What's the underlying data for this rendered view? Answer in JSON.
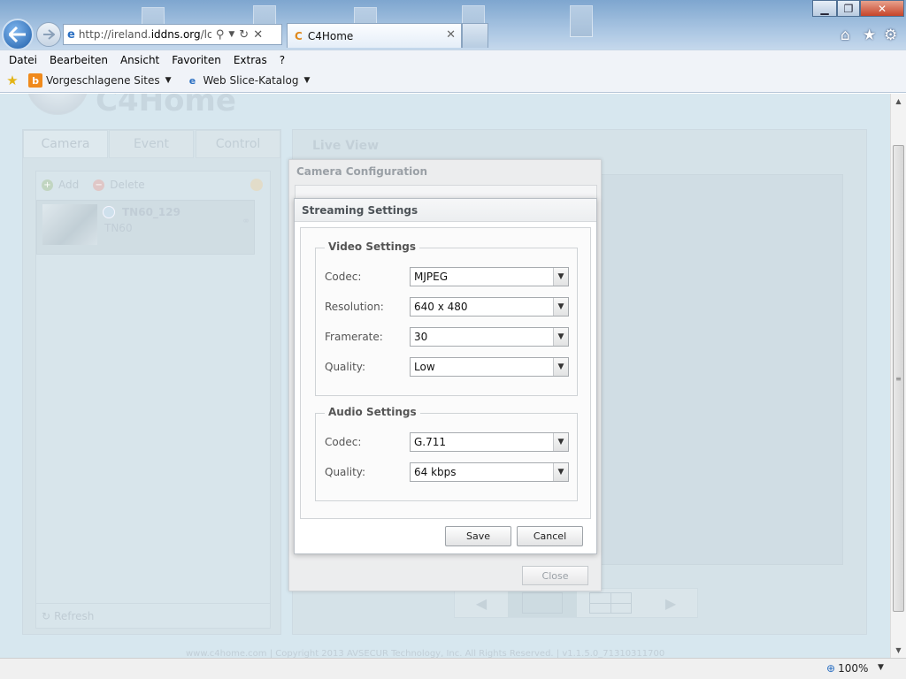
{
  "browser": {
    "url_prefix": "http://ireland.",
    "url_domain": "iddns.org",
    "url_suffix": "/login",
    "tab_title": "C4Home",
    "menu": [
      "Datei",
      "Bearbeiten",
      "Ansicht",
      "Favoriten",
      "Extras",
      "?"
    ],
    "favorites": [
      "Vorgeschlagene Sites",
      "Web Slice-Katalog"
    ],
    "zoom": "100%"
  },
  "app": {
    "logo": "C4Home",
    "tabs": [
      "Camera",
      "Event",
      "Control"
    ],
    "toolbar": {
      "add": "Add",
      "delete": "Delete"
    },
    "camera": {
      "name": "TN60_129",
      "model": "TN60"
    },
    "refresh": "Refresh",
    "live_view_title": "Live View",
    "footer": "www.c4home.com     |    Copyright 2013 AVSECUR Technology, Inc. All Rights Reserved.    |       v1.1.5.0_71310311700"
  },
  "camera_config": {
    "title": "Camera Configuration",
    "close": "Close"
  },
  "streaming": {
    "title": "Streaming Settings",
    "video": {
      "legend": "Video Settings",
      "codec_label": "Codec:",
      "codec": "MJPEG",
      "resolution_label": "Resolution:",
      "resolution": "640 x 480",
      "framerate_label": "Framerate:",
      "framerate": "30",
      "quality_label": "Quality:",
      "quality": "Low"
    },
    "audio": {
      "legend": "Audio Settings",
      "codec_label": "Codec:",
      "codec": "G.711",
      "quality_label": "Quality:",
      "quality": "64 kbps"
    },
    "save": "Save",
    "cancel": "Cancel"
  }
}
